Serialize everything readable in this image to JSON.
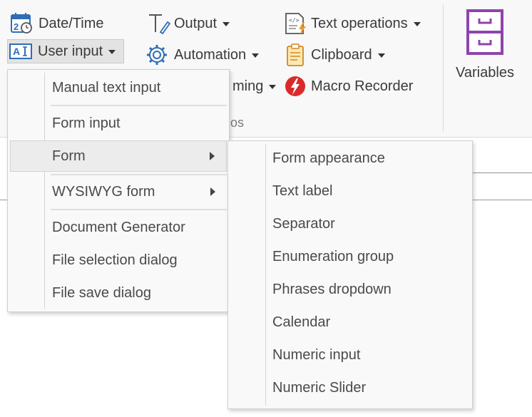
{
  "ribbon": {
    "buttons": {
      "date_time": "Date/Time",
      "user_input": "User input",
      "output": "Output",
      "automation": "Automation",
      "programming": "ming",
      "text_operations": "Text operations",
      "clipboard": "Clipboard",
      "macro_recorder": "Macro Recorder",
      "variables": "Variables"
    },
    "group_label": "os"
  },
  "user_input_menu": {
    "items": [
      {
        "label": "Manual text input"
      },
      {
        "label": "Form input"
      },
      {
        "label": "Form",
        "has_submenu": true,
        "highlighted": true
      },
      {
        "label": "WYSIWYG form",
        "has_submenu": true
      },
      {
        "label": "Document Generator"
      },
      {
        "label": "File selection dialog"
      },
      {
        "label": "File save dialog"
      }
    ]
  },
  "form_submenu": {
    "items": [
      {
        "label": "Form appearance"
      },
      {
        "label": "Text label"
      },
      {
        "label": "Separator"
      },
      {
        "label": "Enumeration group"
      },
      {
        "label": "Phrases dropdown"
      },
      {
        "label": "Calendar"
      },
      {
        "label": "Numeric input"
      },
      {
        "label": "Numeric Slider"
      }
    ]
  },
  "colors": {
    "icon_blue": "#2f6db5",
    "icon_purple": "#8e44ad",
    "icon_red": "#d92b2b",
    "icon_orange": "#e59b2e",
    "menu_bg": "#f9f9f9",
    "highlight_bg": "#ececec"
  },
  "icons": [
    "calendar-icon",
    "text-cursor-icon",
    "pen-output-icon",
    "gear-icon",
    "code-document-icon",
    "clipboard-icon",
    "lightning-macro-icon",
    "cabinet-icon",
    "submenu-arrow-icon"
  ]
}
